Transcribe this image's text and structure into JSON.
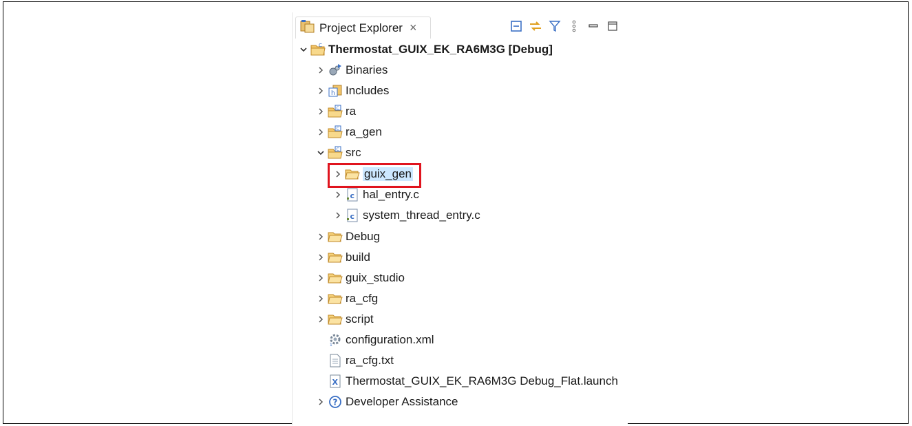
{
  "view": {
    "tab_title": "Project Explorer",
    "close_glyph": "×",
    "toolbar": [
      {
        "name": "collapse-all-icon"
      },
      {
        "name": "link-with-editor-icon"
      },
      {
        "name": "filter-icon"
      },
      {
        "name": "view-menu-icon"
      },
      {
        "name": "minimize-icon"
      },
      {
        "name": "maximize-icon"
      }
    ]
  },
  "tree": {
    "project": "Thermostat_GUIX_EK_RA6M3G [Debug]",
    "items": {
      "binaries": "Binaries",
      "includes": "Includes",
      "ra": "ra",
      "ra_gen": "ra_gen",
      "src": "src",
      "guix_gen": "guix_gen",
      "hal_entry": "hal_entry.c",
      "system_thread_entry": "system_thread_entry.c",
      "debug": "Debug",
      "build": "build",
      "guix_studio": "guix_studio",
      "ra_cfg": "ra_cfg",
      "script": "script",
      "configuration": "configuration.xml",
      "ra_cfg_txt": "ra_cfg.txt",
      "launch": "Thermostat_GUIX_EK_RA6M3G Debug_Flat.launch",
      "dev_assist": "Developer Assistance"
    }
  },
  "colors": {
    "folder": "#e8a93a",
    "highlight": "#e0141e",
    "selection": "#cce8ff",
    "icon_blue": "#3a6fc4"
  }
}
